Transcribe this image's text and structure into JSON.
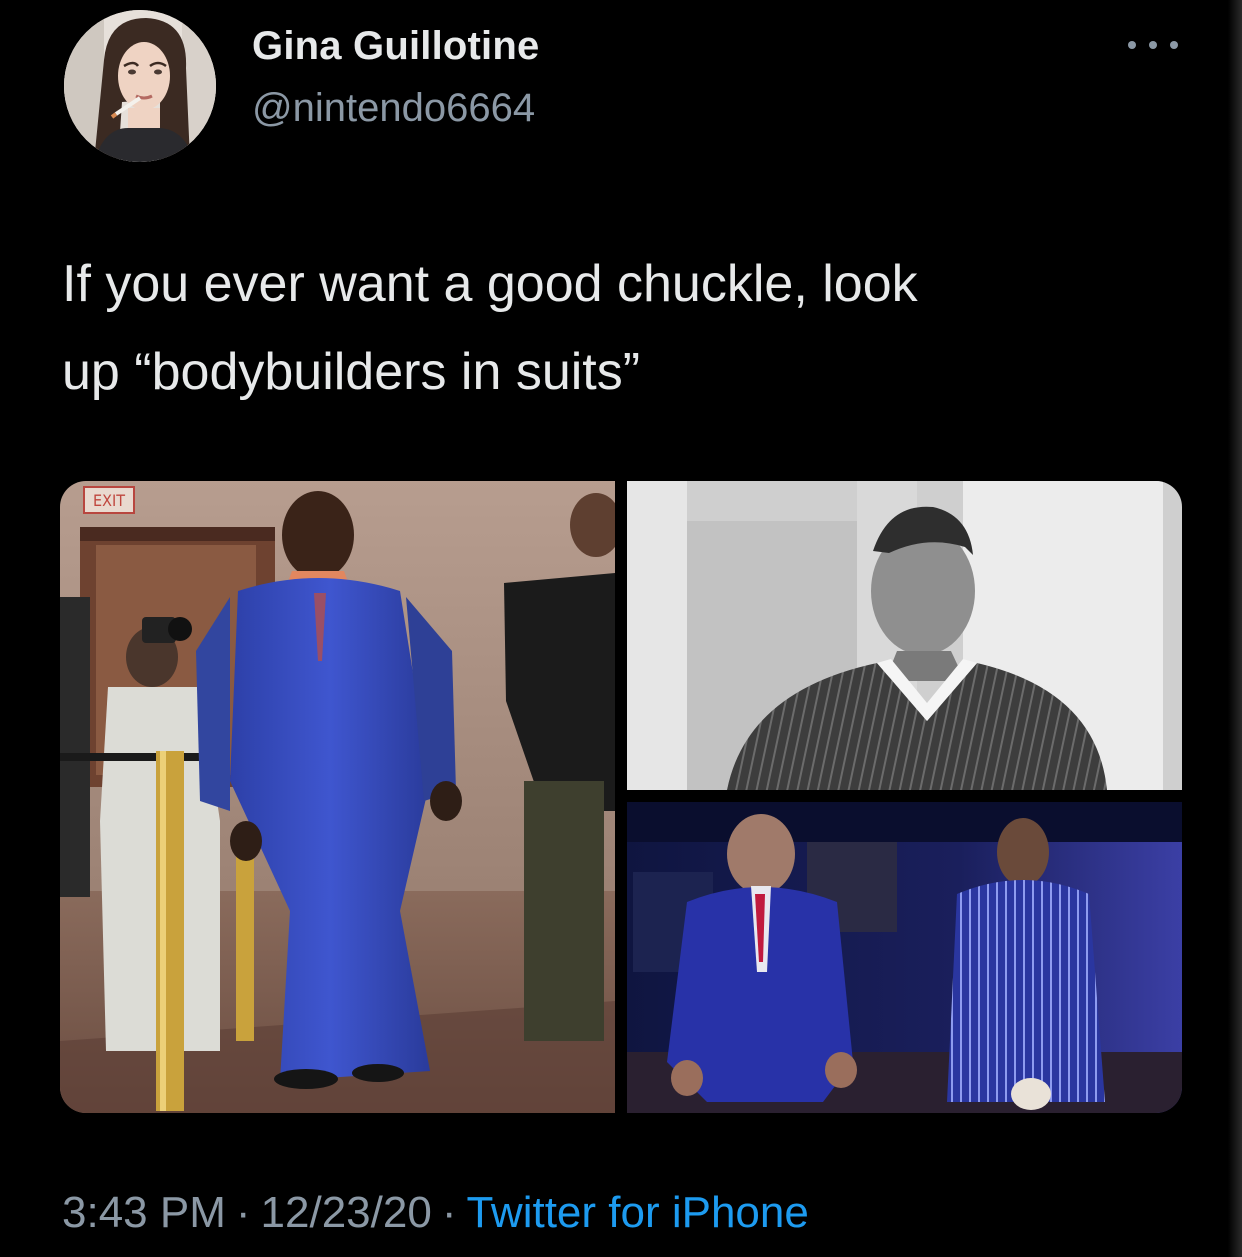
{
  "tweet": {
    "author": {
      "display_name": "Gina Guillotine",
      "handle": "@nintendo6664"
    },
    "text_lines": [
      "If you ever want a good chuckle, look",
      "up “bodybuilders in suits”"
    ],
    "media_sign_text": "EXIT",
    "meta": {
      "time": "3:43 PM",
      "date": "12/23/20",
      "separator": "·",
      "source": "Twitter for iPhone"
    }
  },
  "icons": {
    "more": "more-horizontal-icon"
  },
  "colors": {
    "background": "#000000",
    "primary_text": "#e7e9ea",
    "secondary_text": "#8b98a5",
    "link": "#1d9bf0"
  }
}
